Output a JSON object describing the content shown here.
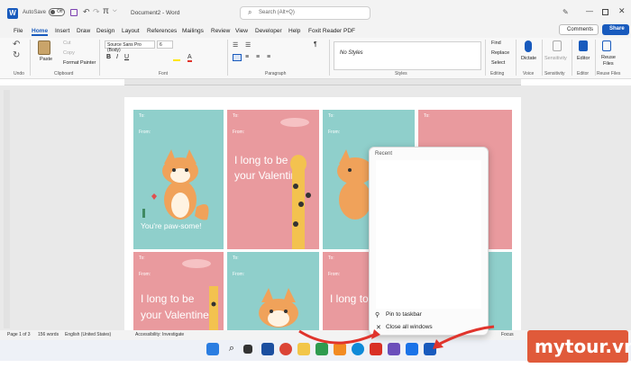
{
  "titlebar": {
    "autosave": "AutoSave",
    "toggle": "Off",
    "doc_title": "Document2 - Word",
    "search_placeholder": "Search (Alt+Q)"
  },
  "tabs": [
    "File",
    "Home",
    "Insert",
    "Draw",
    "Design",
    "Layout",
    "References",
    "Mailings",
    "Review",
    "View",
    "Developer",
    "Help",
    "Foxit Reader PDF"
  ],
  "top_right": {
    "comments": "Comments",
    "share": "Share"
  },
  "ribbon": {
    "undo_label": "Undo",
    "clipboard": {
      "paste": "Paste",
      "cut": "Cut",
      "copy": "Copy",
      "format_painter": "Format Painter",
      "label": "Clipboard"
    },
    "font": {
      "name": "Source Sans Pro (Body)",
      "size": "6",
      "label": "Font"
    },
    "paragraph_label": "Paragraph",
    "styles": {
      "current": "No Styles",
      "label": "Styles"
    },
    "editing": {
      "find": "Find",
      "replace": "Replace",
      "select": "Select",
      "label": "Editing"
    },
    "voice": {
      "dictate": "Dictate",
      "label": "Voice"
    },
    "sensitivity": {
      "btn": "Sensitivity",
      "label": "Sensitivity"
    },
    "editor": {
      "btn": "Editor",
      "label": "Editor"
    },
    "reuse": {
      "btn1": "Reuse",
      "btn2": "Files",
      "label": "Reuse Files"
    }
  },
  "cards": {
    "to": "To:",
    "from": "From:",
    "paw": "You're paw-some!",
    "valentine1": "I long to be",
    "valentine2": "your Valentine"
  },
  "status": {
    "page": "Page 1 of 3",
    "words": "156 words",
    "lang": "English (United States)",
    "access": "Accessibility: Investigate",
    "focus": "Focus"
  },
  "popup": {
    "header": "Recent",
    "pin": "Pin to taskbar",
    "close": "Close all windows"
  },
  "watermark": "mytour.vn",
  "colors": {
    "accent": "#185abd",
    "teal": "#8fcfcb",
    "pink": "#e99a9e",
    "arrow": "#e0342c"
  }
}
